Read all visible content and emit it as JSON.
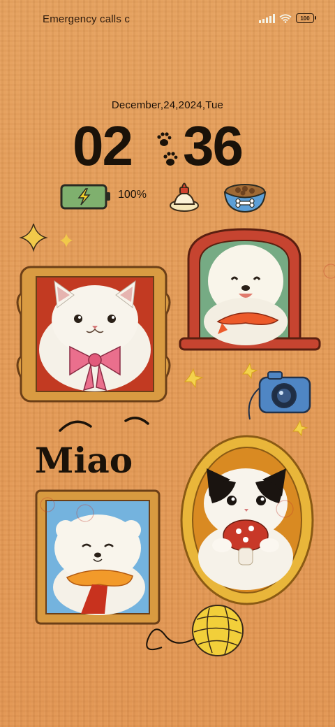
{
  "status_bar": {
    "carrier_text": "Emergency calls c",
    "battery_level": "100",
    "icons": [
      "signal-icon",
      "wifi-icon",
      "battery-icon"
    ]
  },
  "lockscreen": {
    "date": "December,24,2024,Tue",
    "time_hours": "02",
    "time_minutes": "36",
    "battery_percent": "100%"
  },
  "artwork": {
    "title_text": "Miao",
    "items": [
      "cat-portrait",
      "dog-portrait",
      "bear-portrait",
      "calico-cat-portrait",
      "camera-icon",
      "yarn-ball-icon",
      "sparkle-icon"
    ]
  },
  "colors": {
    "background": "#e49a55",
    "clock_text": "#1a1209",
    "frame_gold": "#e0a43a",
    "frame_red": "#c9402a"
  }
}
